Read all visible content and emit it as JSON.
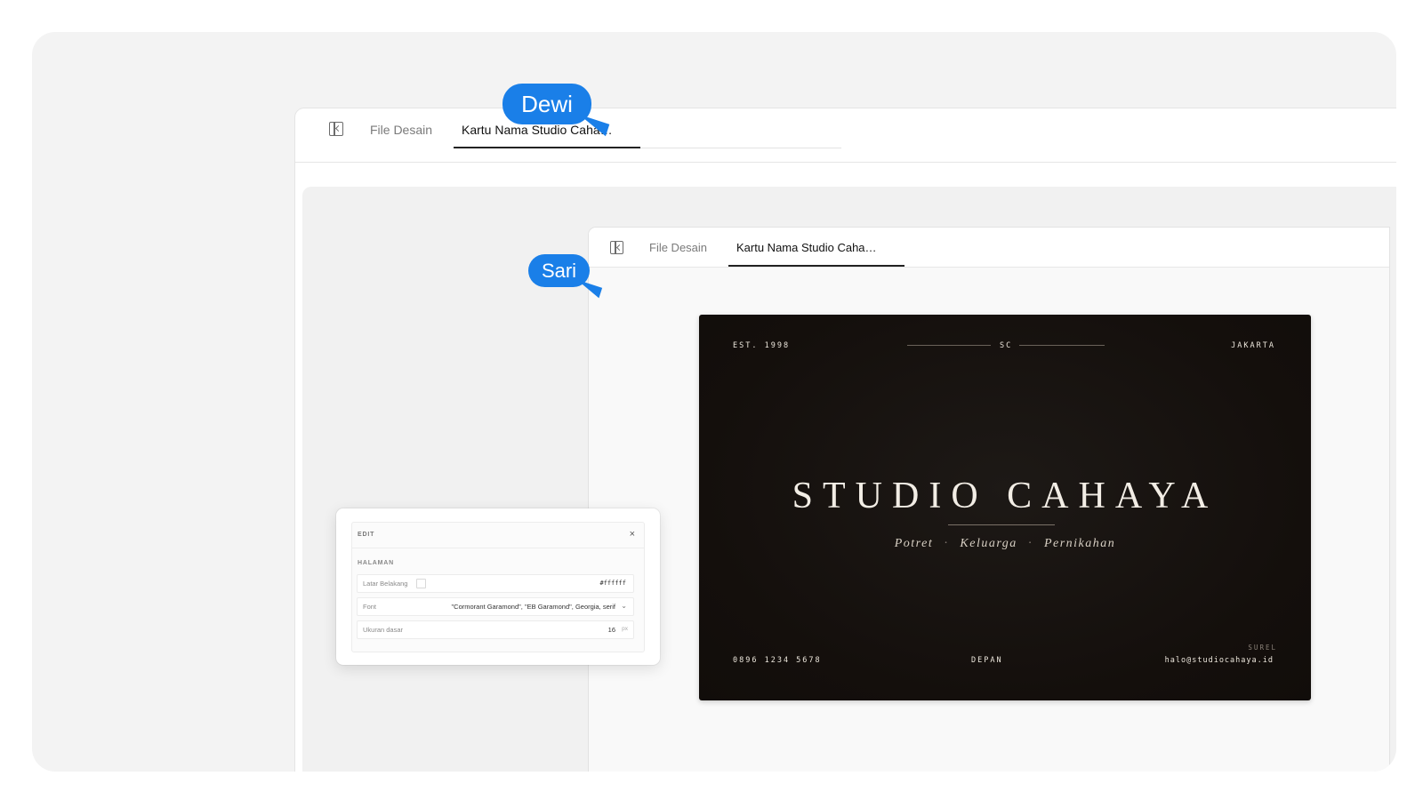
{
  "outer_window": {
    "tabs": [
      {
        "label": "File Desain",
        "active": false
      },
      {
        "label": "Kartu Nama Studio Caha…",
        "active": true
      }
    ]
  },
  "inner_window": {
    "tabs": [
      {
        "label": "File Desain",
        "active": false
      },
      {
        "label": "Kartu Nama Studio Caha…",
        "active": true
      }
    ]
  },
  "card": {
    "est": "EST. 1998",
    "monogram": "SC",
    "city": "JAKARTA",
    "brand": "STUDIO CAHAYA",
    "tagline": [
      "Potret",
      "Keluarga",
      "Pernikahan"
    ],
    "separator": "·",
    "phone": "0896 1234 5678",
    "side": "DEPAN",
    "email_label": "SUREL",
    "email": "halo@studiocahaya.id",
    "background_color": "#140f0c",
    "text_color": "#ece6dc"
  },
  "edit_panel": {
    "title": "EDIT",
    "close_glyph": "×",
    "section": "HALAMAN",
    "rows": [
      {
        "label": "Latar Belakang",
        "value": "#ffffff"
      },
      {
        "label": "Font",
        "value": "\"Cormorant Garamond\", \"EB Garamond\", Georgia, serif"
      },
      {
        "label": "Ukuran dasar",
        "value": "16",
        "unit": "px"
      }
    ]
  },
  "collaborators": [
    {
      "name": "Dewi",
      "color": "#1a7fe8"
    },
    {
      "name": "Sari",
      "color": "#1a7fe8"
    }
  ],
  "icons": [
    "sidebar-toggle-icon",
    "close-icon",
    "chevron-down-icon",
    "cursor-pointer-icon"
  ]
}
